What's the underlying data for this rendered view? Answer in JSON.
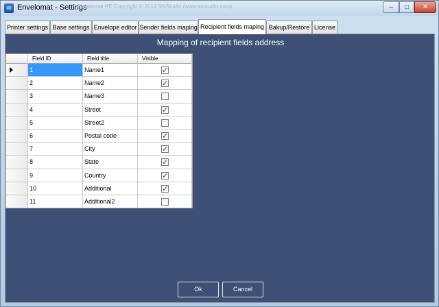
{
  "window": {
    "title": "Envelomat - Settings",
    "watermark": "Envelomat PE Copyright © 2012 SNStudio (www.snstudio.com)"
  },
  "tabs": [
    {
      "label": "Printer settings"
    },
    {
      "label": "Base settings"
    },
    {
      "label": "Envelope editor"
    },
    {
      "label": "Sender fields maping"
    },
    {
      "label": "Recipient fields maping",
      "active": true
    },
    {
      "label": "Bakup/Restore"
    },
    {
      "label": "License"
    }
  ],
  "panel": {
    "heading": "Mapping of recipient fields address"
  },
  "grid": {
    "columns": {
      "id": "Field ID",
      "title": "Field title",
      "visible": "Visible"
    },
    "rows": [
      {
        "id": "1",
        "title": "Name1",
        "visible": true
      },
      {
        "id": "2",
        "title": "Name2",
        "visible": true
      },
      {
        "id": "3",
        "title": "Name3",
        "visible": false
      },
      {
        "id": "4",
        "title": "Street",
        "visible": true
      },
      {
        "id": "5",
        "title": "Street2",
        "visible": false
      },
      {
        "id": "6",
        "title": "Postal code",
        "visible": true
      },
      {
        "id": "7",
        "title": "City",
        "visible": true
      },
      {
        "id": "8",
        "title": "State",
        "visible": true
      },
      {
        "id": "9",
        "title": "Country",
        "visible": true
      },
      {
        "id": "10",
        "title": "Additional",
        "visible": true
      },
      {
        "id": "11",
        "title": "Additional2",
        "visible": false
      }
    ]
  },
  "buttons": {
    "ok": "Ok",
    "cancel": "Cancel"
  },
  "colors": {
    "panel_bg": "#3e5075",
    "selected_cell": "#3399ff"
  }
}
